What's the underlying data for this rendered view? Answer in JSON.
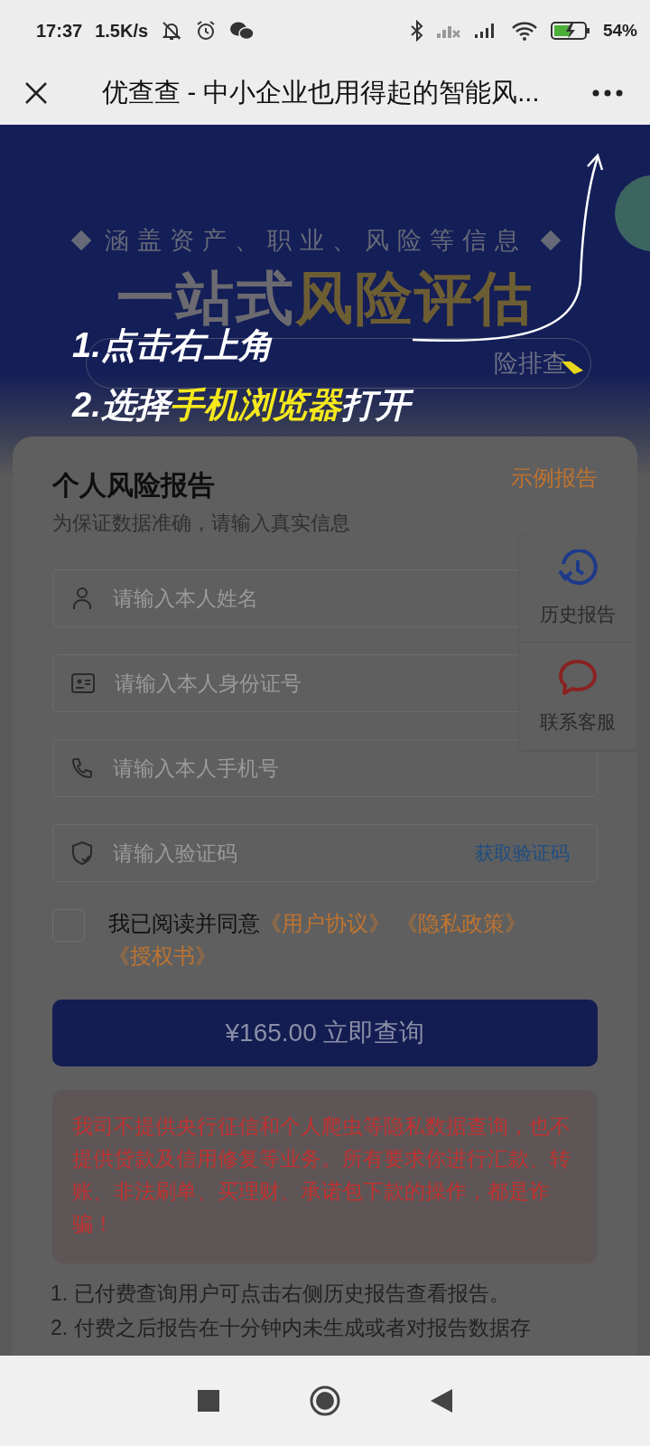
{
  "status_bar": {
    "time": "17:37",
    "speed": "1.5K/s",
    "battery": "54%"
  },
  "title_bar": {
    "title": "优查查 - 中小企业也用得起的智能风..."
  },
  "banner": {
    "tagline": "涵盖资产、职业、风险等信息",
    "headline": [
      {
        "text": "一站式",
        "color": "#6a6a70"
      },
      {
        "text": "风险评估",
        "color": "#6d5d33"
      }
    ],
    "pill": "险排查"
  },
  "guide": {
    "steps": [
      [
        {
          "text": "1.点击右上角",
          "highlight": false
        }
      ],
      [
        {
          "text": "2.选择",
          "highlight": false
        },
        {
          "text": "手机浏览器",
          "highlight": true
        },
        {
          "text": "打开",
          "highlight": false
        }
      ]
    ]
  },
  "card": {
    "title": "个人风险报告",
    "example_link": "示例报告",
    "subtitle": "为保证数据准确，请输入真实信息",
    "fields": [
      {
        "kind": "name",
        "placeholder": "请输入本人姓名"
      },
      {
        "kind": "id",
        "placeholder": "请输入本人身份证号"
      },
      {
        "kind": "phone",
        "placeholder": "请输入本人手机号"
      },
      {
        "kind": "code",
        "placeholder": "请输入验证码",
        "action": "获取验证码"
      }
    ],
    "agreement": {
      "checked": false,
      "text": "我已阅读并同意",
      "links": [
        "《用户协议》",
        "《隐私政策》",
        "《授权书》"
      ]
    },
    "submit": "¥165.00 立即查询",
    "warning": "我司不提供央行征信和个人爬虫等隐私数据查询，也不提供贷款及信用修复等业务。所有要求你进行汇款、转账、非法刷单、买理财、承诺包下款的操作，都是诈骗！",
    "notes": [
      "1. 已付费查询用户可点击右侧历史报告查看报告。",
      "2. 付费之后报告在十分钟内未生成或者对报告数据存"
    ]
  },
  "side_panel": [
    {
      "kind": "history",
      "label": "历史报告"
    },
    {
      "kind": "service",
      "label": "联系客服"
    }
  ]
}
